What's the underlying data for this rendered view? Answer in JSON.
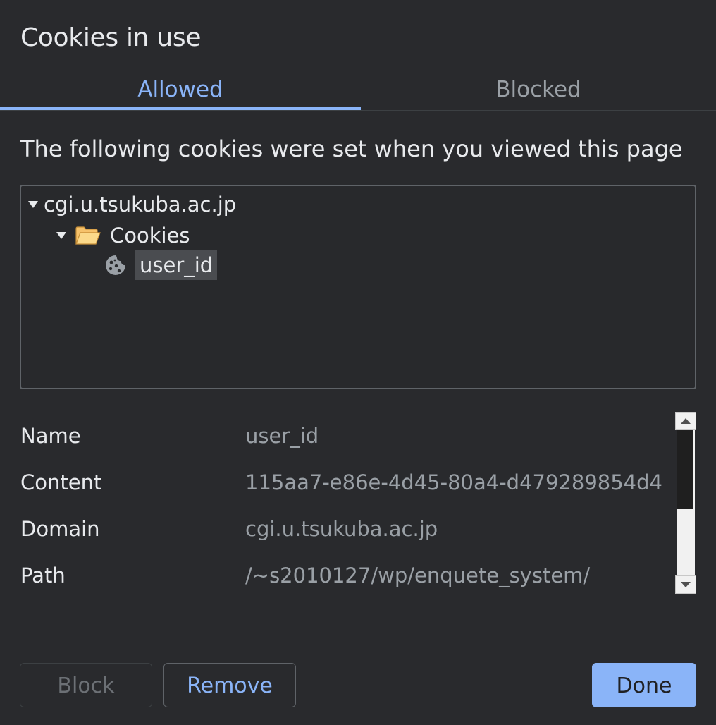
{
  "dialog": {
    "title": "Cookies in use"
  },
  "tabs": [
    {
      "label": "Allowed",
      "selected": true
    },
    {
      "label": "Blocked",
      "selected": false
    }
  ],
  "description": "The following cookies were set when you viewed this page",
  "tree": {
    "site": "cgi.u.tsukuba.ac.jp",
    "folder": "Cookies",
    "cookie": "user_id"
  },
  "details": [
    {
      "label": "Name",
      "value": "user_id"
    },
    {
      "label": "Content",
      "value": "115aa7-e86e-4d45-80a4-d479289854d4"
    },
    {
      "label": "Domain",
      "value": "cgi.u.tsukuba.ac.jp"
    },
    {
      "label": "Path",
      "value": "/~s2010127/wp/enquete_system/"
    }
  ],
  "buttons": {
    "block": "Block",
    "remove": "Remove",
    "done": "Done"
  },
  "colors": {
    "background": "#292a2d",
    "accent": "#8ab4f8",
    "text": "#e8eaed",
    "muted": "#9aa0a6"
  }
}
